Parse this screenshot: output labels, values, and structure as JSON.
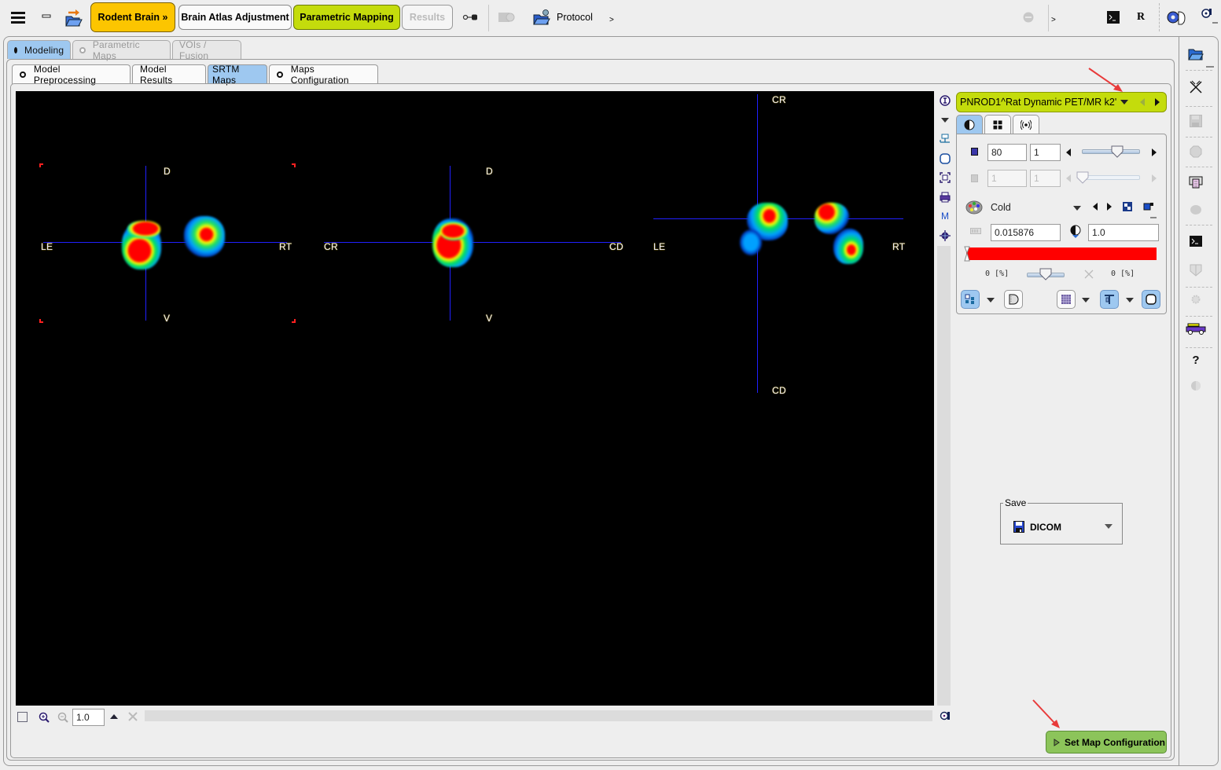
{
  "toolbar": {
    "menu_icon": "hamburger-menu-icon",
    "minimize_icon": "minimize-icon",
    "open_icon": "open-folder-arrow-icon",
    "workflow_buttons": [
      {
        "label": "Rodent Brain »",
        "state": "active",
        "color": "#fcc500"
      },
      {
        "label": "Brain Atlas Adjustment",
        "state": "normal"
      },
      {
        "label": "Parametric Mapping",
        "state": "selected",
        "color": "#c4dc0c"
      },
      {
        "label": "Results",
        "state": "disabled"
      }
    ],
    "protocol_label": "Protocol",
    "more_label": ">",
    "more_label2": ">",
    "r_label": "R"
  },
  "main_tabs": [
    {
      "label": "Modeling",
      "state": "active",
      "radio": true
    },
    {
      "label": "Parametric Maps",
      "state": "disabled",
      "radio": true
    },
    {
      "label": "VOIs / Fusion",
      "state": "disabled",
      "radio": false
    }
  ],
  "sub_tabs": [
    {
      "label": "Model Preprocessing",
      "radio": true,
      "state": "normal"
    },
    {
      "label": "Model Results",
      "radio": false,
      "state": "normal"
    },
    {
      "label": "SRTM Maps",
      "radio": false,
      "state": "active"
    },
    {
      "label": "Maps Configuration",
      "radio": true,
      "state": "normal"
    }
  ],
  "viewer": {
    "views": [
      {
        "name": "coronal",
        "labels": {
          "top": "D",
          "bottom": "V",
          "left": "LE",
          "right": "RT"
        }
      },
      {
        "name": "sagittal",
        "labels": {
          "top": "D",
          "bottom": "V",
          "left": "CR",
          "right": "CD"
        }
      },
      {
        "name": "axial",
        "labels": {
          "top": "CR",
          "bottom": "CD",
          "left": "LE",
          "right": "RT"
        }
      }
    ],
    "zoom_value": "1.0"
  },
  "image_panel": {
    "series_name": "PNROD1^Rat Dynamic PET/MR k2'",
    "tabs": [
      "contrast-tab",
      "layout-tab",
      "signal-tab"
    ],
    "slice_value": "80",
    "slice_step": "1",
    "frame_value": "1",
    "frame_step": "1",
    "colormap": "Cold",
    "min_value": "0.015876",
    "max_value": "1.0",
    "threshold_low": "0 [%]",
    "threshold_high": "0 [%]",
    "colorbar_color": "#ff0000"
  },
  "save": {
    "legend": "Save",
    "format": "DICOM"
  },
  "actions": {
    "set_map_configuration": "Set Map Configuration"
  },
  "colors": {
    "accent_yellow": "#fcc500",
    "accent_green": "#c4dc0c",
    "tab_active": "#9ec8f0",
    "button_green": "#8cc45a",
    "crosshair": "#2020ff"
  }
}
